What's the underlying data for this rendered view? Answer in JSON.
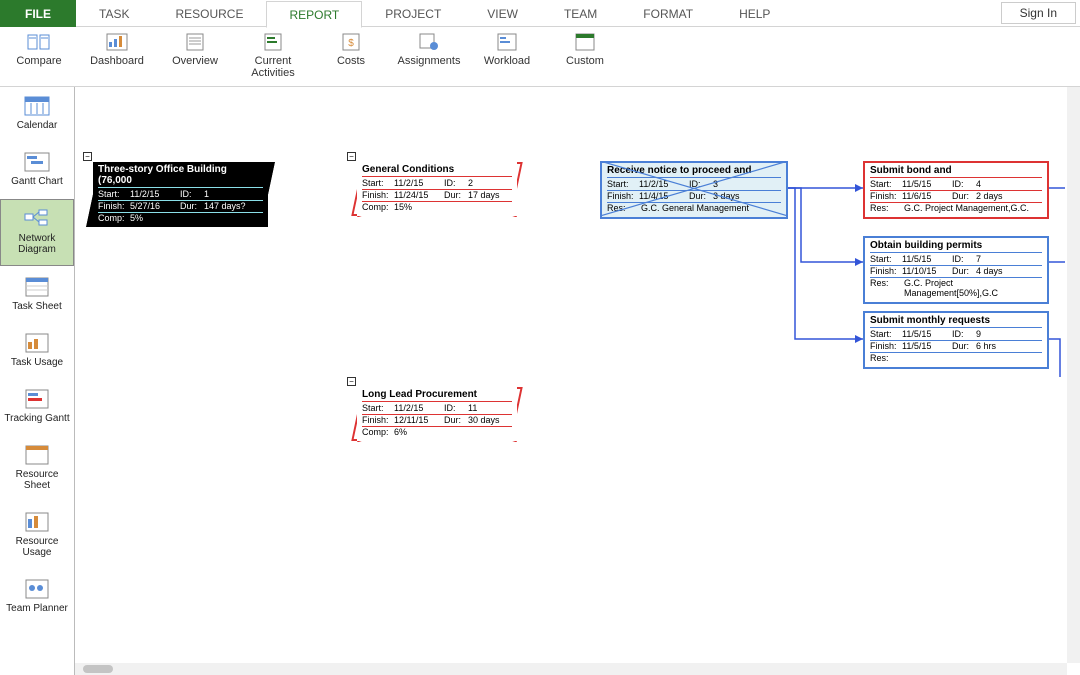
{
  "menu": {
    "file": "FILE",
    "tabs": [
      "TASK",
      "RESOURCE",
      "REPORT",
      "PROJECT",
      "VIEW",
      "TEAM",
      "FORMAT",
      "HELP"
    ],
    "active": "REPORT",
    "signin": "Sign In"
  },
  "ribbon": [
    {
      "label": "Compare",
      "icon": "compare-icon"
    },
    {
      "label": "Dashboard",
      "icon": "dashboard-icon"
    },
    {
      "label": "Overview",
      "icon": "overview-icon"
    },
    {
      "label": "Current Activities",
      "icon": "activities-icon"
    },
    {
      "label": "Costs",
      "icon": "costs-icon"
    },
    {
      "label": "Assignments",
      "icon": "assignments-icon"
    },
    {
      "label": "Workload",
      "icon": "workload-icon"
    },
    {
      "label": "Custom",
      "icon": "custom-icon"
    }
  ],
  "views": [
    {
      "label": "Calendar"
    },
    {
      "label": "Gantt Chart"
    },
    {
      "label": "Network Diagram",
      "active": true
    },
    {
      "label": "Task Sheet"
    },
    {
      "label": "Task Usage"
    },
    {
      "label": "Tracking Gantt"
    },
    {
      "label": "Resource Sheet"
    },
    {
      "label": "Resource Usage"
    },
    {
      "label": "Team Planner"
    }
  ],
  "tasks": {
    "t1": {
      "title": "Three-story Office Building (76,000",
      "start": "11/2/15",
      "id": "1",
      "finish": "5/27/16",
      "dur": "147 days?",
      "comp": "5%"
    },
    "t2": {
      "title": "General Conditions",
      "start": "11/2/15",
      "id": "2",
      "finish": "11/24/15",
      "dur": "17 days",
      "comp": "15%"
    },
    "t3": {
      "title": "Receive notice to proceed and",
      "start": "11/2/15",
      "id": "3",
      "finish": "11/4/15",
      "dur": "3 days",
      "res": "G.C. General Management"
    },
    "t4": {
      "title": "Submit bond and",
      "start": "11/5/15",
      "id": "4",
      "finish": "11/6/15",
      "dur": "2 days",
      "res": "G.C. Project Management,G.C."
    },
    "t7": {
      "title": "Obtain building permits",
      "start": "11/5/15",
      "id": "7",
      "finish": "11/10/15",
      "dur": "4 days",
      "res": "G.C. Project Management[50%],G.C"
    },
    "t9": {
      "title": "Submit monthly requests",
      "start": "11/5/15",
      "id": "9",
      "finish": "11/5/15",
      "dur": "6 hrs",
      "res": ""
    },
    "t11": {
      "title": "Long Lead Procurement",
      "start": "11/2/15",
      "id": "11",
      "finish": "12/11/15",
      "dur": "30 days",
      "comp": "6%"
    }
  },
  "labels": {
    "start": "Start:",
    "finish": "Finish:",
    "id": "ID:",
    "dur": "Dur:",
    "comp": "Comp:",
    "res": "Res:"
  }
}
